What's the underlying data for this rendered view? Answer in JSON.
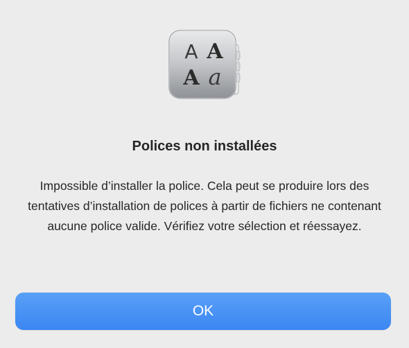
{
  "dialog": {
    "icon_name": "font-book-icon",
    "icon_glyphs": [
      "A",
      "A",
      "A",
      "a"
    ],
    "title": "Polices non installées",
    "message": "Impossible d’installer la police. Cela peut se produire lors des tentatives d’installation de polices à partir de fichiers ne contenant aucune police valide. Vérifiez votre sélection et réessayez.",
    "ok_label": "OK"
  },
  "colors": {
    "background": "#ececec",
    "accent": "#3b86f2",
    "text": "#262626"
  }
}
